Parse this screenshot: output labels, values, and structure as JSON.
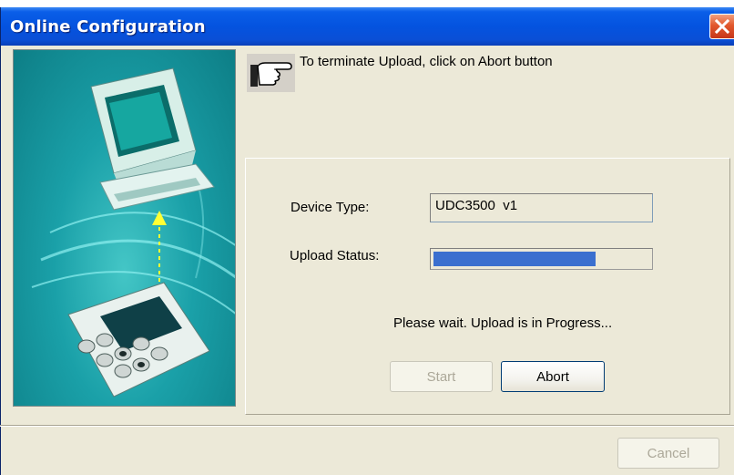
{
  "window": {
    "title": "Online Configuration",
    "close_icon": "close-x-icon"
  },
  "hint": {
    "icon": "pointing-hand-icon",
    "text": "To terminate Upload, click on Abort button"
  },
  "form": {
    "device_type_label": "Device Type:",
    "device_type_value": "UDC3500  v1",
    "upload_status_label": "Upload Status:",
    "upload_progress_percent": 75,
    "status_message": "Please wait. Upload is in Progress..."
  },
  "buttons": {
    "start_label": "Start",
    "abort_label": "Abort",
    "cancel_label": "Cancel"
  },
  "colors": {
    "titlebar": "#0453df",
    "progress": "#3a6fcf",
    "illustration_bg": "#1aa0a8",
    "dialog_bg": "#ece9d8"
  }
}
